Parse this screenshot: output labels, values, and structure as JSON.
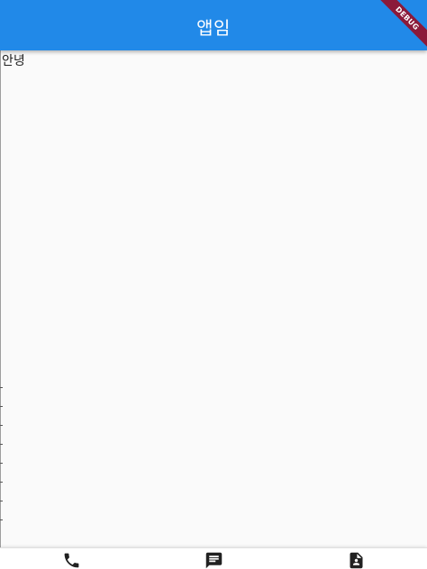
{
  "appbar": {
    "title": "앱임"
  },
  "debug_banner": {
    "label": "DEBUG"
  },
  "body": {
    "greeting": "안녕"
  },
  "bottom_nav": {
    "items": [
      {
        "icon": "phone-icon"
      },
      {
        "icon": "message-icon"
      },
      {
        "icon": "contact-icon"
      }
    ]
  },
  "colors": {
    "appbar": "#2189e8",
    "background": "#fafafa",
    "debug_banner": "#8b1a3a",
    "nav_icon": "#212121"
  }
}
